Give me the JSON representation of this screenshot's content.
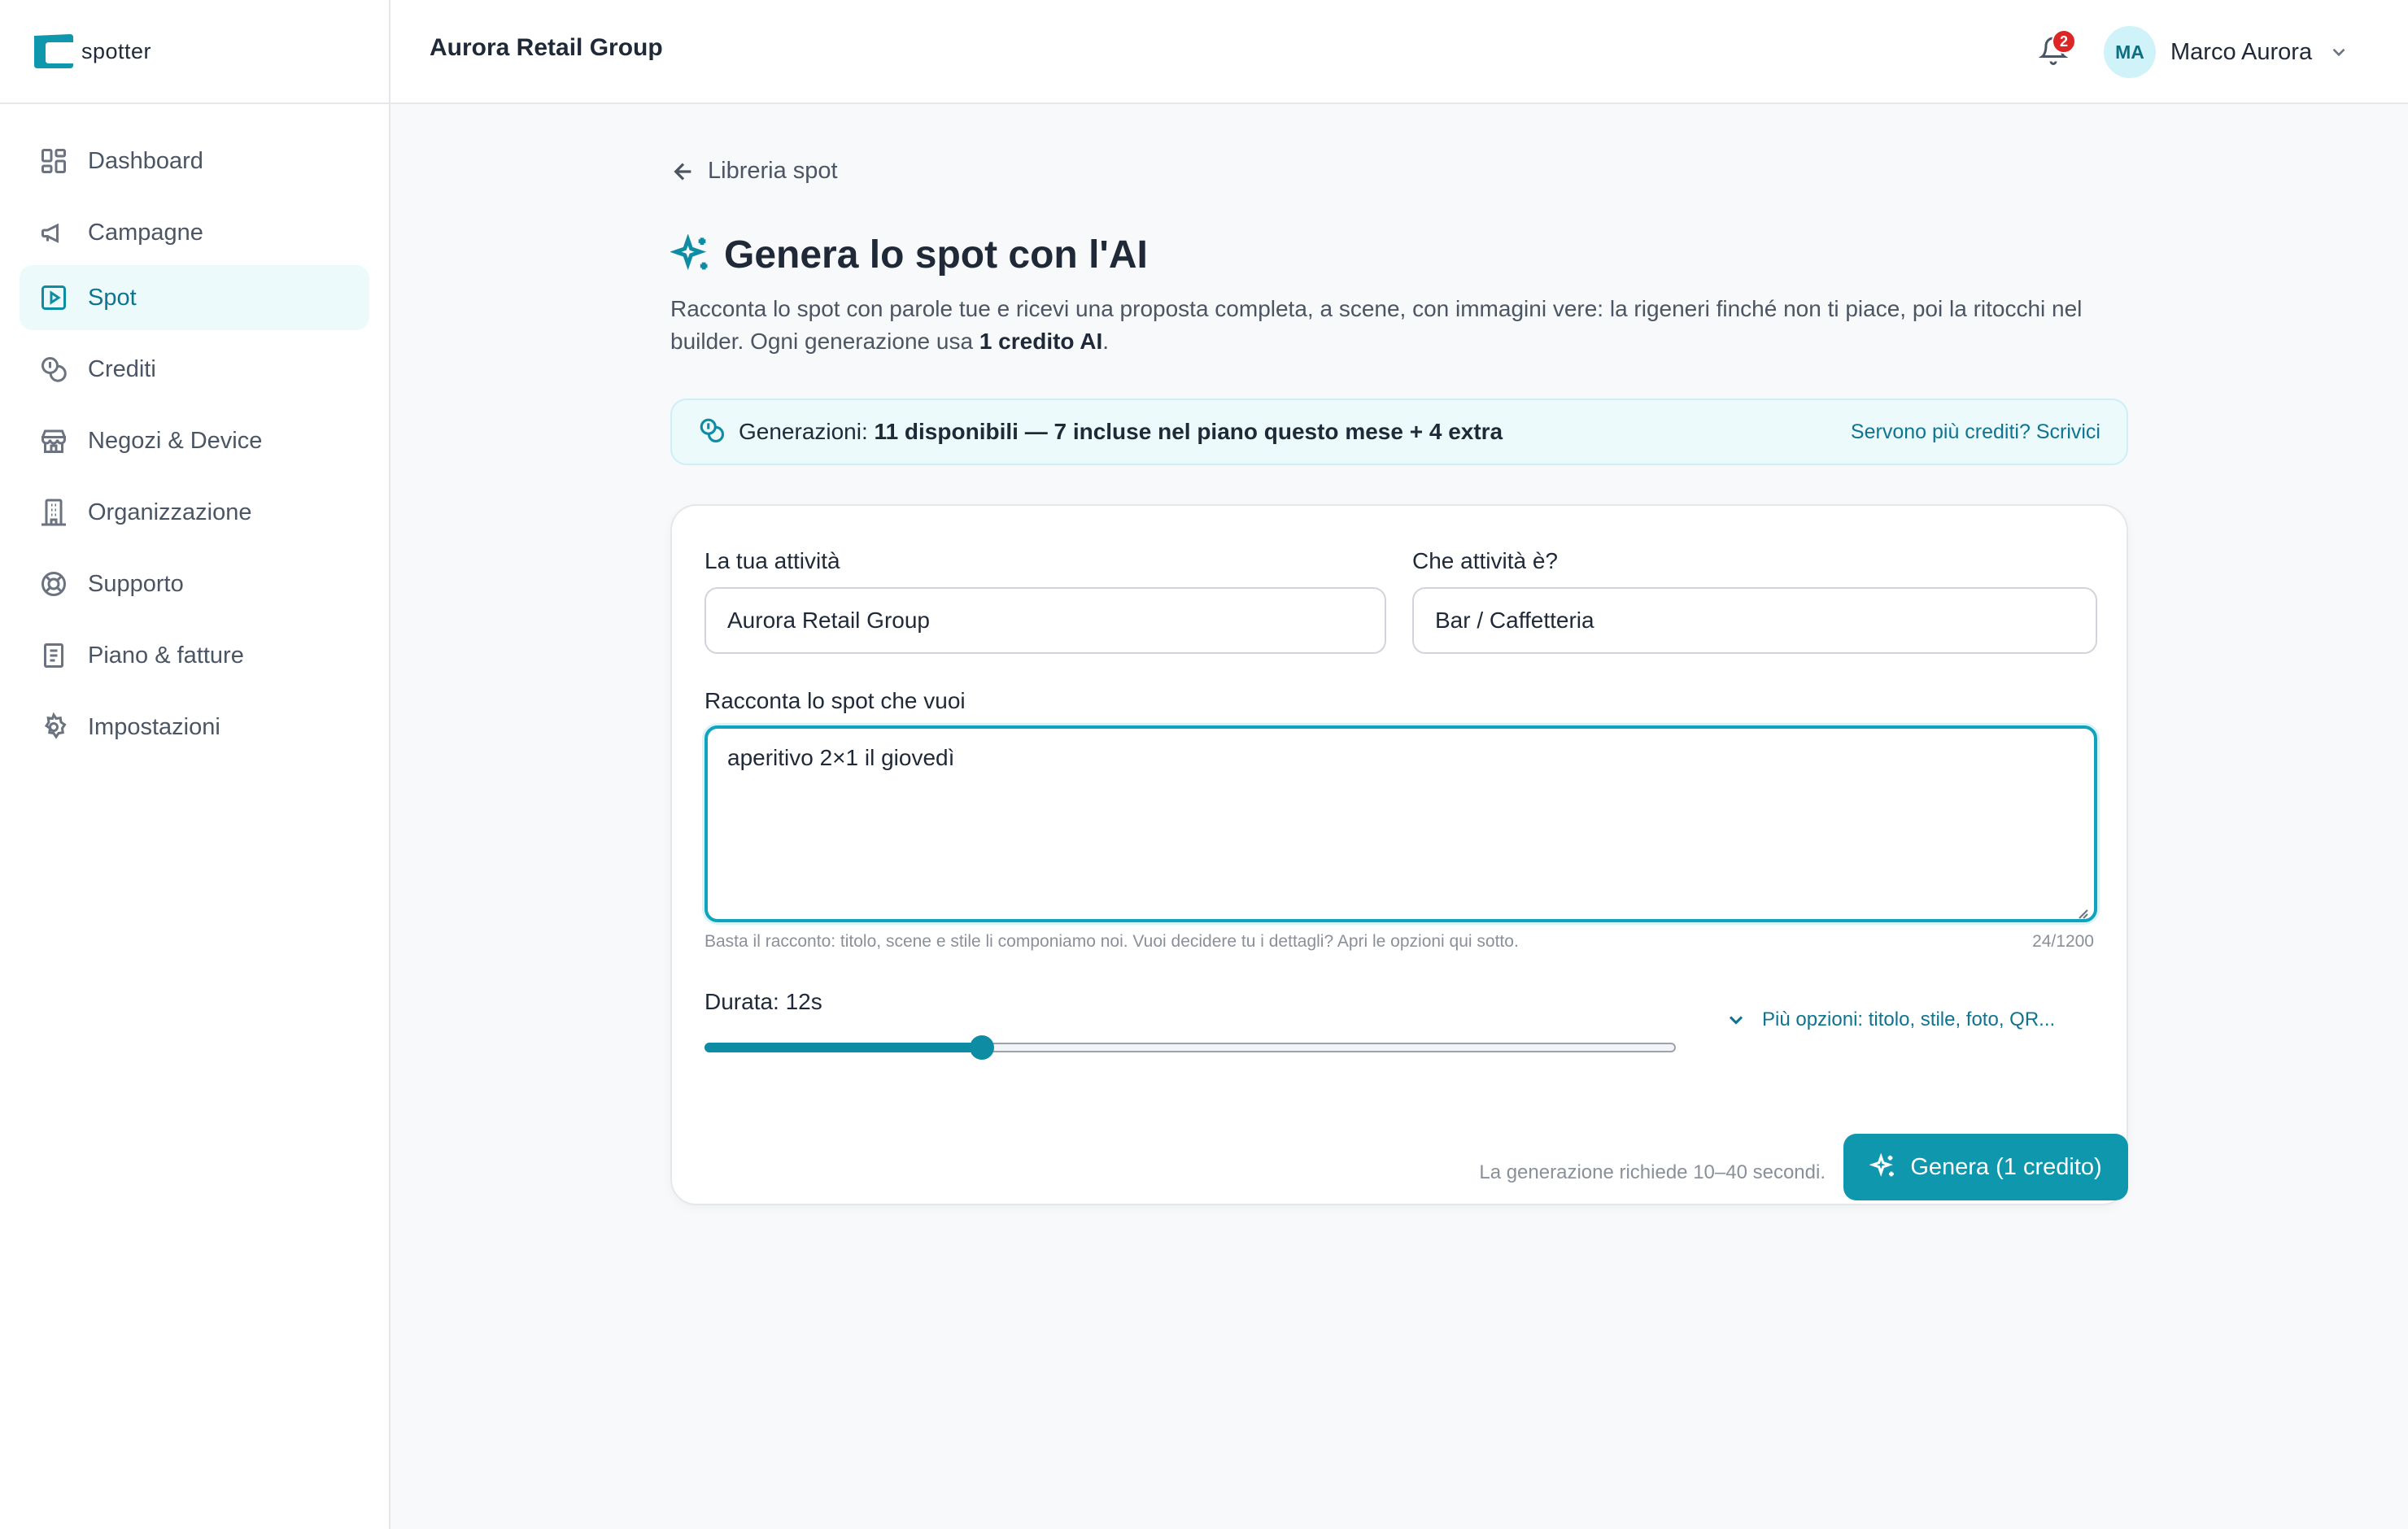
{
  "brand": {
    "name": "spotter"
  },
  "sidebar": {
    "items": [
      {
        "label": "Dashboard",
        "icon": "dashboard-icon",
        "active": false
      },
      {
        "label": "Campagne",
        "icon": "megaphone-icon",
        "active": false
      },
      {
        "label": "Spot",
        "icon": "play-square-icon",
        "active": true
      },
      {
        "label": "Crediti",
        "icon": "coins-icon",
        "active": false
      },
      {
        "label": "Negozi & Device",
        "icon": "store-icon",
        "active": false
      },
      {
        "label": "Organizzazione",
        "icon": "building-icon",
        "active": false
      },
      {
        "label": "Supporto",
        "icon": "lifebuoy-icon",
        "active": false
      },
      {
        "label": "Piano & fatture",
        "icon": "receipt-icon",
        "active": false
      },
      {
        "label": "Impostazioni",
        "icon": "gear-icon",
        "active": false
      }
    ]
  },
  "header": {
    "org_name": "Aurora Retail Group",
    "notifications_count": "2",
    "user_initials": "MA",
    "user_name": "Marco Aurora"
  },
  "main": {
    "back_label": "Libreria spot",
    "title": "Genera lo spot con l'AI",
    "intro_text": "Racconta lo spot con parole tue e ricevi una proposta completa, a scene, con immagini vere: la rigeneri finché non ti piace, poi la ritocchi nel builder. Ogni generazione usa ",
    "intro_bold": "1 credito AI",
    "intro_end": ".",
    "credits": {
      "prefix": "Generazioni: ",
      "bold": "11 disponibili — 7 incluse nel piano questo mese + 4 extra",
      "link": "Servono più crediti? Scrivici"
    },
    "form": {
      "business_label": "La tua attività",
      "business_value": "Aurora Retail Group",
      "type_label": "Che attività è?",
      "type_value": "Bar / Caffetteria",
      "story_label": "Racconta lo spot che vuoi",
      "story_value": "aperitivo 2×1 il giovedì",
      "hint": "Basta il racconto: titolo, scene e stile li componiamo noi. Vuoi decidere tu i dettagli? Apri le opzioni qui sotto.",
      "counter": "24/1200",
      "duration_label": "Durata: 12s",
      "duration_fraction": 0.286,
      "more_options": "Più opzioni: titolo, stile, foto, QR..."
    },
    "footer_note": "La generazione richiede 10–40 secondi.",
    "generate_button": "Genera (1 credito)"
  },
  "colors": {
    "accent": "#0e97ad",
    "accent_text": "#0e7490",
    "badge": "#dc2626"
  }
}
